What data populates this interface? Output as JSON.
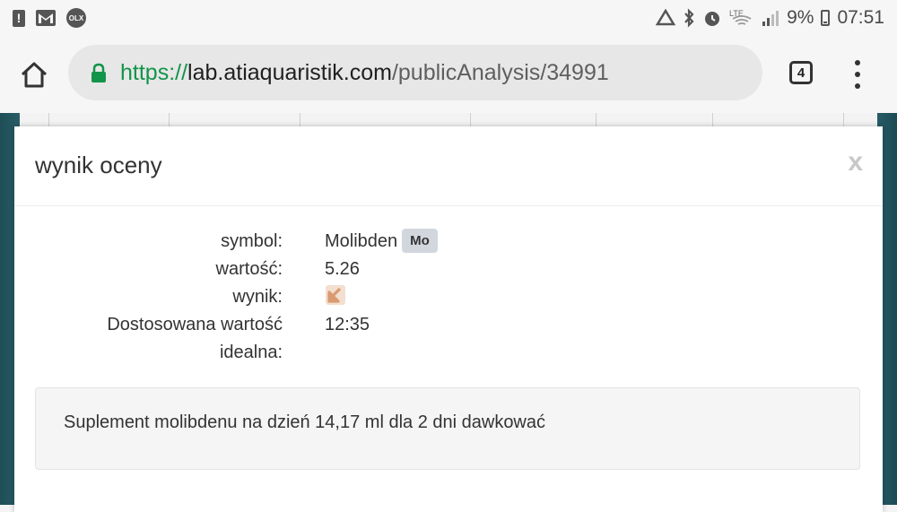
{
  "status_bar": {
    "olx": "OLX",
    "battery": "9%",
    "time": "07:51",
    "icons": [
      "alert-icon",
      "gmail-icon",
      "olx-icon",
      "data-saver-icon",
      "bluetooth-icon",
      "alarm-icon",
      "lte-icon",
      "signal-icon",
      "battery-icon"
    ]
  },
  "browser": {
    "url_scheme": "https://",
    "url_host": "lab.atiaquaristik.com",
    "url_path": "/publicAnalysis/34991",
    "tab_count": "4",
    "secure_color": "#12944a"
  },
  "modal": {
    "title": "wynik oceny",
    "close_label": "x",
    "rows": [
      {
        "label": "symbol:",
        "value": "Molibden",
        "badge": "Mo"
      },
      {
        "label": "wartość:",
        "value": "5.26"
      },
      {
        "label": "wynik:",
        "icon": "arrow-down-left-icon"
      },
      {
        "label": "Dostosowana wartość",
        "value": "12:35"
      },
      {
        "label": "idealna:"
      }
    ],
    "note": "Suplement molibdenu na dzień 14,17 ml dla 2 dni dawkować"
  }
}
